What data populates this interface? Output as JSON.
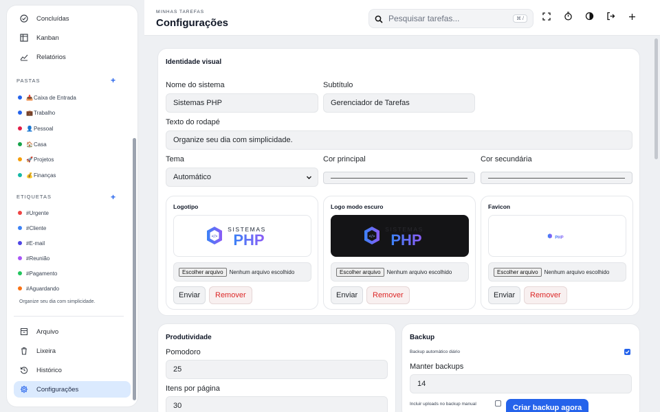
{
  "sidebar": {
    "top_items": [
      {
        "label": "Concluídas",
        "icon": "check-circle-icon"
      },
      {
        "label": "Kanban",
        "icon": "kanban-icon"
      },
      {
        "label": "Relatórios",
        "icon": "chart-icon"
      }
    ],
    "folders_title": "PASTAS",
    "folders": [
      {
        "label": "Caixa de Entrada",
        "emoji": "📥",
        "color": "#2563eb"
      },
      {
        "label": "Trabalho",
        "emoji": "💼",
        "color": "#2563eb"
      },
      {
        "label": "Pessoal",
        "emoji": "👤",
        "color": "#e11d48"
      },
      {
        "label": "Casa",
        "emoji": "🏠",
        "color": "#16a34a"
      },
      {
        "label": "Projetos",
        "emoji": "🚀",
        "color": "#f59e0b"
      },
      {
        "label": "Finanças",
        "emoji": "💰",
        "color": "#14b8a6"
      }
    ],
    "tags_title": "ETIQUETAS",
    "tags": [
      {
        "label": "#Urgente",
        "color": "#ef4444"
      },
      {
        "label": "#Cliente",
        "color": "#3b82f6"
      },
      {
        "label": "#E-mail",
        "color": "#4f46e5"
      },
      {
        "label": "#Reunião",
        "color": "#a855f7"
      },
      {
        "label": "#Pagamento",
        "color": "#22c55e"
      },
      {
        "label": "#Aguardando",
        "color": "#f97316"
      }
    ],
    "footer_text": "Organize seu dia com simplicidade.",
    "bottom_items": [
      {
        "label": "Arquivo",
        "icon": "archive-icon"
      },
      {
        "label": "Lixeira",
        "icon": "trash-icon"
      },
      {
        "label": "Histórico",
        "icon": "history-icon"
      },
      {
        "label": "Configurações",
        "icon": "gear-icon"
      }
    ]
  },
  "header": {
    "breadcrumb": "MINHAS TAREFAS",
    "title": "Configurações",
    "search_placeholder": "Pesquisar tarefas...",
    "shortcut": "⌘ /"
  },
  "visual": {
    "title": "Identidade visual",
    "name_label": "Nome do sistema",
    "name_value": "Sistemas PHP",
    "subtitle_label": "Subtítulo",
    "subtitle_value": "Gerenciador de Tarefas",
    "footer_label": "Texto do rodapé",
    "footer_value": "Organize seu dia com simplicidade.",
    "theme_label": "Tema",
    "theme_value": "Automático",
    "primary_label": "Cor principal",
    "secondary_label": "Cor secundária",
    "uploads": [
      {
        "title": "Logotipo",
        "dark": false
      },
      {
        "title": "Logo modo escuro",
        "dark": true
      },
      {
        "title": "Favicon",
        "dark": false
      }
    ],
    "logo_word_top": "SISTEMAS",
    "logo_word_main": "PHP",
    "file_button": "Escolher arquivo",
    "file_status": "Nenhum arquivo escolhido",
    "send_label": "Enviar",
    "remove_label": "Remover"
  },
  "productivity": {
    "title": "Produtividade",
    "pomodoro_label": "Pomodoro",
    "pomodoro_value": "25",
    "items_label": "Itens por página",
    "items_value": "30"
  },
  "backup": {
    "title": "Backup",
    "daily_label": "Backup automático diário",
    "daily_checked": true,
    "keep_label": "Manter backups",
    "keep_value": "14",
    "uploads_label": "Incluir uploads no backup manual",
    "uploads_checked": false,
    "create_label": "Criar backup agora"
  },
  "colors": {
    "accent": "#2563eb",
    "danger": "#dc2626"
  }
}
